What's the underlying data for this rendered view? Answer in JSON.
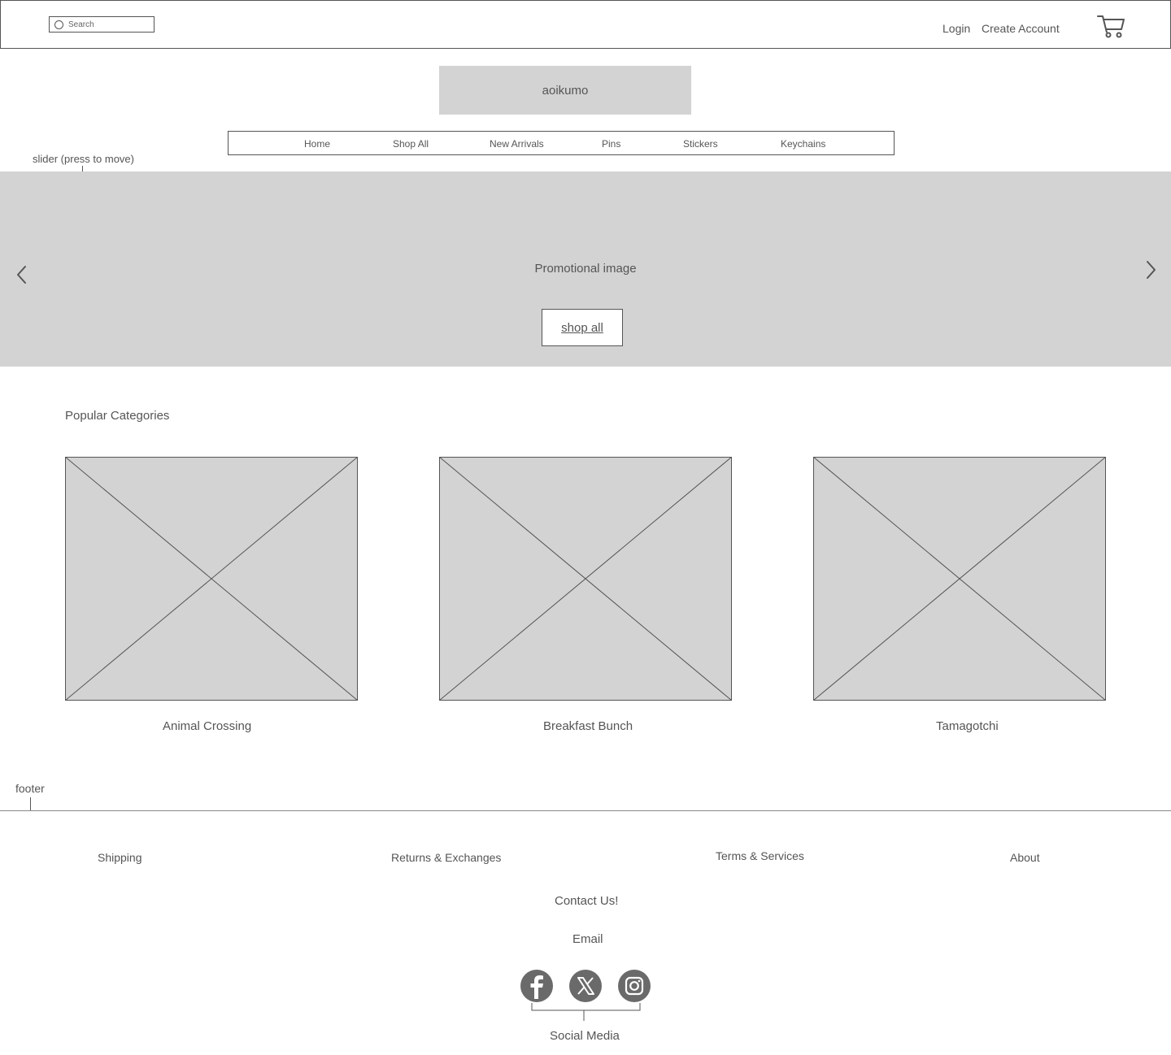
{
  "header": {
    "search_placeholder": "Search",
    "login_label": "Login",
    "create_account_label": "Create Account",
    "cart_icon": "cart-icon"
  },
  "logo": {
    "text": "aoikumo"
  },
  "nav": {
    "items": [
      "Home",
      "Shop All",
      "New Arrivals",
      "Pins",
      "Stickers",
      "Keychains"
    ]
  },
  "slider": {
    "annotation": "slider (press to move)",
    "promo_text": "Promotional image",
    "cta_label": "shop all",
    "prev_icon": "chevron-left-icon",
    "next_icon": "chevron-right-icon"
  },
  "popular": {
    "title": "Popular Categories",
    "categories": [
      "Animal Crossing",
      "Breakfast Bunch",
      "Tamagotchi"
    ]
  },
  "footer": {
    "annotation": "footer",
    "links": [
      "Shipping",
      "Returns & Exchanges",
      "Terms & Services",
      "About"
    ],
    "contact_label": "Contact Us!",
    "email_label": "Email",
    "social_icons": [
      "facebook-icon",
      "x-icon",
      "instagram-icon"
    ],
    "social_label": "Social Media"
  },
  "colors": {
    "placeholder_gray": "#d3d3d3",
    "line_gray": "#555555",
    "social_icon_bg": "#6a6a6a"
  }
}
